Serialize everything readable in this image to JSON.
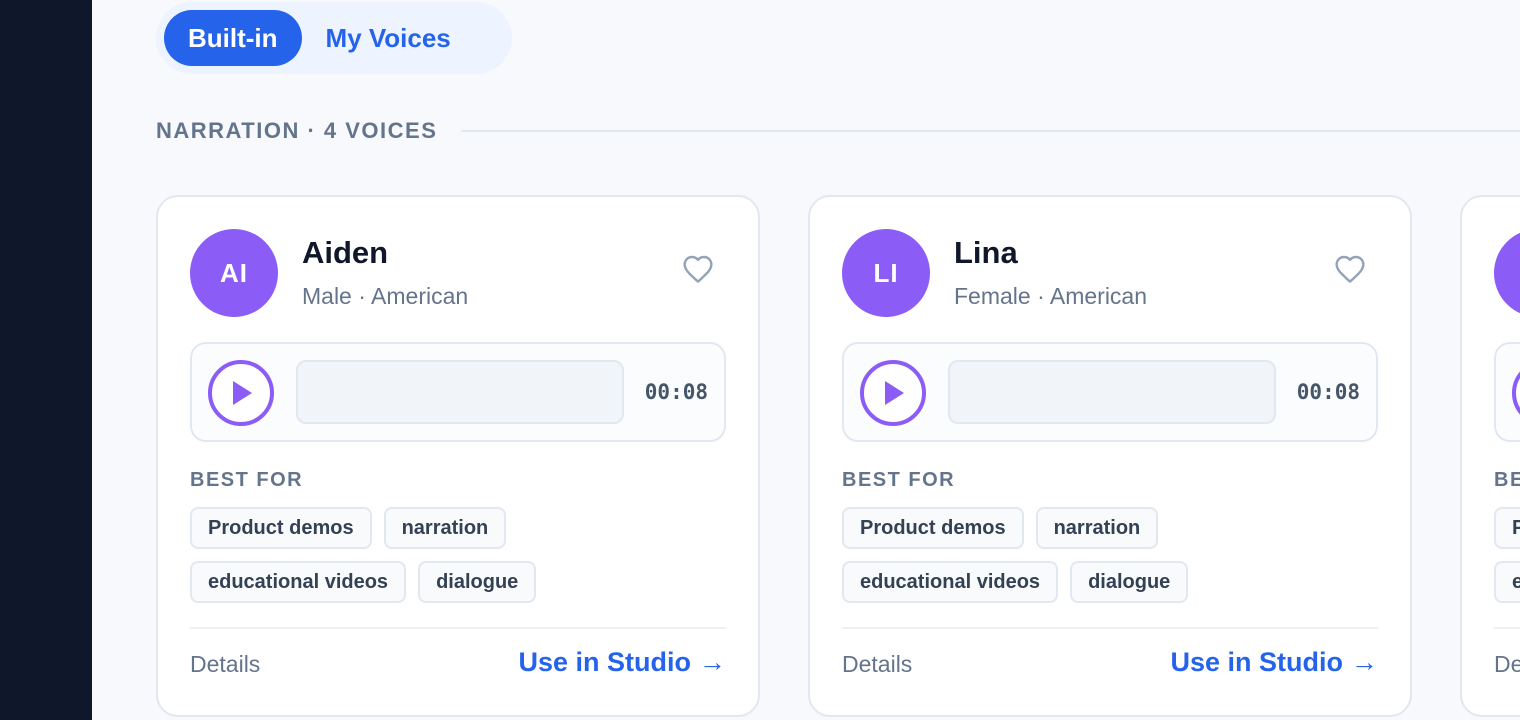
{
  "tabs": [
    {
      "label": "Built-in",
      "active": true
    },
    {
      "label": "My Voices",
      "active": false
    }
  ],
  "section": {
    "title": "NARRATION · 4 VOICES"
  },
  "colors": {
    "accent": "#2563eb",
    "avatar": "#8b5cf6",
    "sidebar": "#0f172a"
  },
  "cards": [
    {
      "initials": "AI",
      "name": "Aiden",
      "meta": "Male · American",
      "duration": "00:08",
      "best_for_label": "BEST FOR",
      "tags": [
        "Product demos",
        "narration",
        "educational videos",
        "dialogue"
      ],
      "details_label": "Details",
      "use_label": "Use in Studio",
      "use_arrow": "→"
    },
    {
      "initials": "LI",
      "name": "Lina",
      "meta": "Female · American",
      "duration": "00:08",
      "best_for_label": "BEST FOR",
      "tags": [
        "Product demos",
        "narration",
        "educational videos",
        "dialogue"
      ],
      "details_label": "Details",
      "use_label": "Use in Studio",
      "use_arrow": "→"
    },
    {
      "initials": "",
      "name": "",
      "meta": "",
      "duration": "",
      "best_for_label": "BE",
      "tags": [
        "P",
        "e"
      ],
      "details_label": "De",
      "use_label": "",
      "use_arrow": ""
    }
  ]
}
